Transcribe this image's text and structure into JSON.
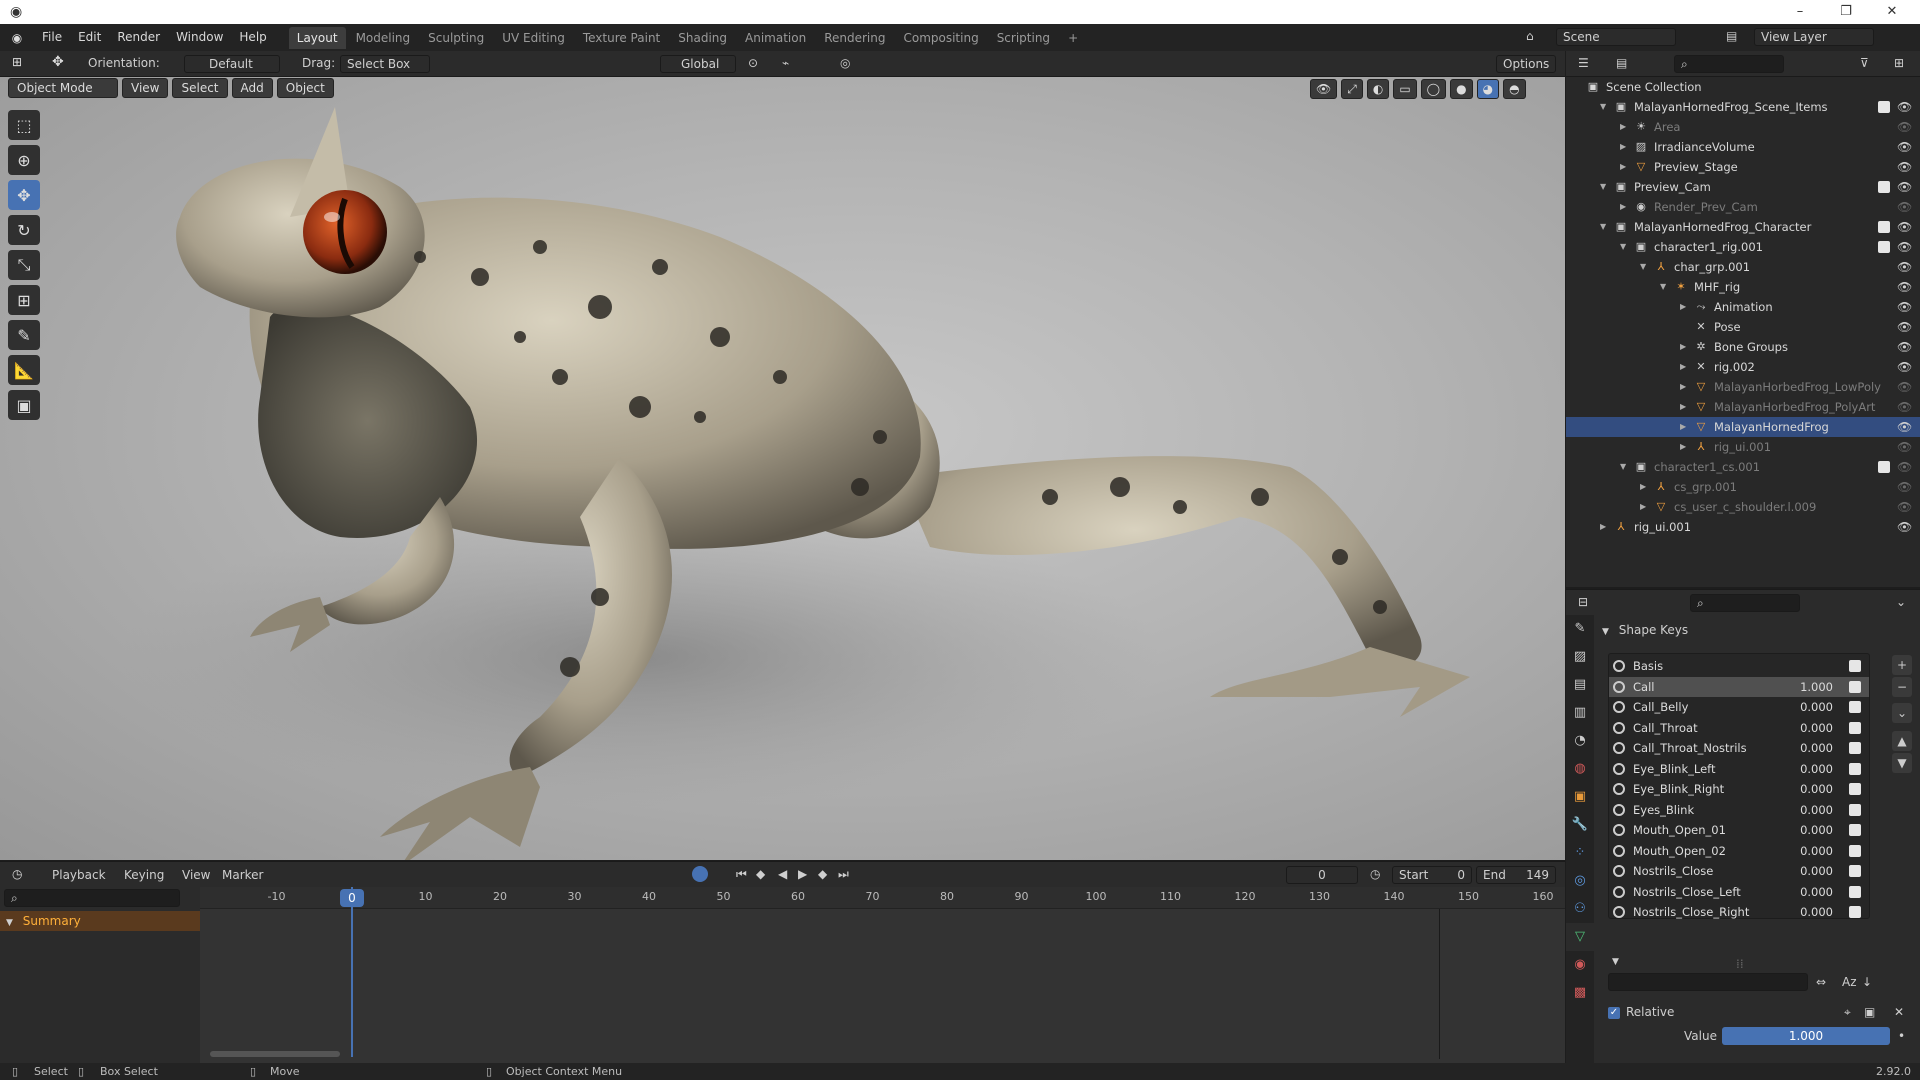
{
  "menus": [
    "File",
    "Edit",
    "Render",
    "Window",
    "Help"
  ],
  "workspaces": [
    "Layout",
    "Modeling",
    "Sculpting",
    "UV Editing",
    "Texture Paint",
    "Shading",
    "Animation",
    "Rendering",
    "Compositing",
    "Scripting",
    "+"
  ],
  "scene": "Scene",
  "view_layer": "View Layer",
  "header3d": {
    "orientation_label": "Orientation:",
    "orientation": "Default",
    "drag_label": "Drag:",
    "drag": "Select Box",
    "global": "Global",
    "options": "Options"
  },
  "viewport_header": {
    "mode": "Object Mode",
    "view": "View",
    "select": "Select",
    "add": "Add",
    "object": "Object"
  },
  "timeline": {
    "playback": "Playback",
    "keying": "Keying",
    "view": "View",
    "marker": "Marker",
    "frame": "0",
    "start_label": "Start",
    "start": "0",
    "end_label": "End",
    "end": "149",
    "summary": "Summary",
    "current_frame": "0",
    "ticks": [
      "-10",
      "0",
      "10",
      "20",
      "30",
      "40",
      "50",
      "60",
      "70",
      "80",
      "90",
      "100",
      "110",
      "120",
      "130",
      "140",
      "150",
      "160"
    ]
  },
  "outliner": {
    "title": "Scene Collection",
    "rows": [
      {
        "name": "MalayanHornedFrog_Scene_Items",
        "depth": 1,
        "tri": "▼",
        "icon": "▣",
        "dim": false,
        "chk": true
      },
      {
        "name": "Area",
        "depth": 2,
        "tri": "▶",
        "icon": "☀",
        "dim": true,
        "chk": false
      },
      {
        "name": "IrradianceVolume",
        "depth": 2,
        "tri": "▶",
        "icon": "▨",
        "dim": false,
        "chk": false
      },
      {
        "name": "Preview_Stage",
        "depth": 2,
        "tri": "▶",
        "icon": "▽",
        "dim": false,
        "chk": false
      },
      {
        "name": "Preview_Cam",
        "depth": 1,
        "tri": "▼",
        "icon": "▣",
        "dim": false,
        "chk": true
      },
      {
        "name": "Render_Prev_Cam",
        "depth": 2,
        "tri": "▶",
        "icon": "◉",
        "dim": true,
        "chk": false
      },
      {
        "name": "MalayanHornedFrog_Character",
        "depth": 1,
        "tri": "▼",
        "icon": "▣",
        "dim": false,
        "chk": true
      },
      {
        "name": "character1_rig.001",
        "depth": 2,
        "tri": "▼",
        "icon": "▣",
        "dim": false,
        "chk": true
      },
      {
        "name": "char_grp.001",
        "depth": 3,
        "tri": "▼",
        "icon": "⅄",
        "dim": false,
        "chk": false
      },
      {
        "name": "MHF_rig",
        "depth": 4,
        "tri": "▼",
        "icon": "✶",
        "dim": false,
        "chk": false
      },
      {
        "name": "Animation",
        "depth": 5,
        "tri": "▶",
        "icon": "⤳",
        "dim": false,
        "chk": false
      },
      {
        "name": "Pose",
        "depth": 5,
        "tri": "",
        "icon": "✕",
        "dim": false,
        "chk": false
      },
      {
        "name": "Bone Groups",
        "depth": 5,
        "tri": "▶",
        "icon": "✲",
        "dim": false,
        "chk": false
      },
      {
        "name": "rig.002",
        "depth": 5,
        "tri": "▶",
        "icon": "✕",
        "dim": false,
        "chk": false
      },
      {
        "name": "MalayanHorbedFrog_LowPoly",
        "depth": 5,
        "tri": "▶",
        "icon": "▽",
        "dim": true,
        "chk": false
      },
      {
        "name": "MalayanHorbedFrog_PolyArt",
        "depth": 5,
        "tri": "▶",
        "icon": "▽",
        "dim": true,
        "chk": false
      },
      {
        "name": "MalayanHornedFrog",
        "depth": 5,
        "tri": "▶",
        "icon": "▽",
        "dim": false,
        "chk": false,
        "sel": true
      },
      {
        "name": "rig_ui.001",
        "depth": 5,
        "tri": "▶",
        "icon": "⅄",
        "dim": true,
        "chk": false
      },
      {
        "name": "character1_cs.001",
        "depth": 2,
        "tri": "▼",
        "icon": "▣",
        "dim": true,
        "chk": true
      },
      {
        "name": "cs_grp.001",
        "depth": 3,
        "tri": "▶",
        "icon": "⅄",
        "dim": true,
        "chk": false
      },
      {
        "name": "cs_user_c_shoulder.l.009",
        "depth": 3,
        "tri": "▶",
        "icon": "▽",
        "dim": true,
        "chk": false
      },
      {
        "name": "rig_ui.001",
        "depth": 1,
        "tri": "▶",
        "icon": "⅄",
        "dim": false,
        "chk": false
      }
    ]
  },
  "shape_keys": {
    "title": "Shape Keys",
    "keys": [
      {
        "name": "Basis",
        "value": ""
      },
      {
        "name": "Call",
        "value": "1.000",
        "sel": true
      },
      {
        "name": "Call_Belly",
        "value": "0.000"
      },
      {
        "name": "Call_Throat",
        "value": "0.000"
      },
      {
        "name": "Call_Throat_Nostrils",
        "value": "0.000"
      },
      {
        "name": "Eye_Blink_Left",
        "value": "0.000"
      },
      {
        "name": "Eye_Blink_Right",
        "value": "0.000"
      },
      {
        "name": "Eyes_Blink",
        "value": "0.000"
      },
      {
        "name": "Mouth_Open_01",
        "value": "0.000"
      },
      {
        "name": "Mouth_Open_02",
        "value": "0.000"
      },
      {
        "name": "Nostrils_Close",
        "value": "0.000"
      },
      {
        "name": "Nostrils_Close_Left",
        "value": "0.000"
      },
      {
        "name": "Nostrils_Close_Right",
        "value": "0.000"
      }
    ],
    "relative": "Relative",
    "value_label": "Value",
    "value": "1.000",
    "value_fraction": 1.0
  },
  "status": {
    "select": "Select",
    "box_select": "Box Select",
    "move": "Move",
    "context": "Object Context Menu",
    "version": "2.92.0"
  },
  "colors": {
    "accent": "#4772b3",
    "selected_row": "#334d80",
    "frog_eye": "#b8431a"
  }
}
